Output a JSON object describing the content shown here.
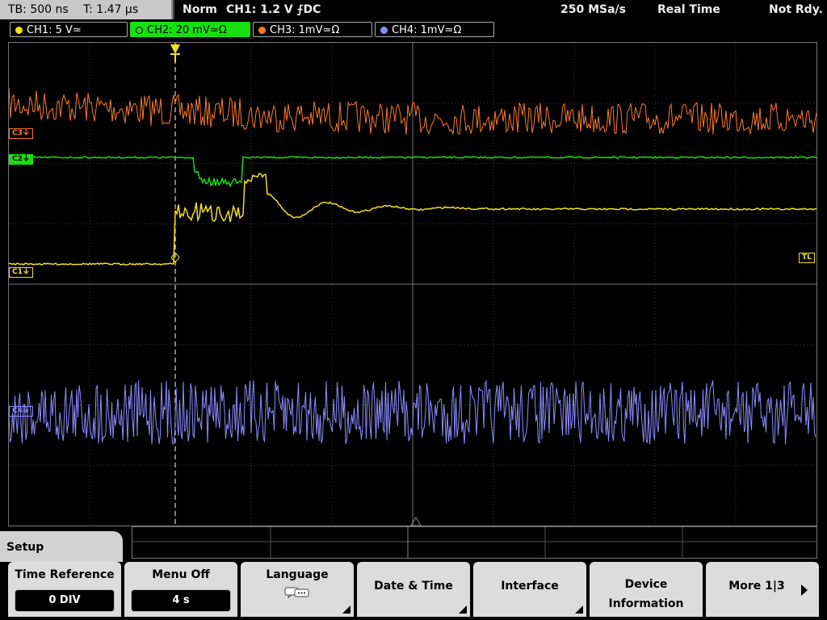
{
  "statusbar": {
    "timebase": "TB: 500 ns",
    "trigger_time": "T: 1.47 µs",
    "mode": "Norm",
    "trigger": "CH1: 1.2 V ⨍DC",
    "sample_rate": "250 MSa/s",
    "acq_mode": "Real Time",
    "state": "Not Rdy."
  },
  "channels": [
    {
      "label": "CH1: 5 V≃",
      "color": "#f0e020"
    },
    {
      "label": "CH2: 20 mV≃Ω",
      "color": "#16e00e"
    },
    {
      "label": "CH3: 1mV≃Ω",
      "color": "#ff7a28"
    },
    {
      "label": "CH4: 1mV≃Ω",
      "color": "#8c8cff"
    }
  ],
  "markers": {
    "c3": "C3⏚",
    "c2": "C2⏚",
    "c1": "C1⏚",
    "c4": "C4⏚",
    "tl": "TL"
  },
  "menu": {
    "title": "Setup"
  },
  "softkeys": {
    "time_reference": {
      "label": "Time Reference",
      "value": "0 DIV"
    },
    "menu_off": {
      "label": "Menu Off",
      "value": "4 s"
    },
    "language": {
      "label": "Language",
      "icon": "speech-bubbles-icon"
    },
    "date_time": {
      "label": "Date & Time"
    },
    "interface": {
      "label": "Interface"
    },
    "device_info": {
      "label1": "Device",
      "label2": "Information"
    },
    "more": {
      "label": "More 1|3"
    }
  },
  "colors": {
    "ch1": "#f0e020",
    "ch2": "#16e00e",
    "ch3": "#ff7a28",
    "ch4": "#8c8cff",
    "softkey_bg": "#dcdcdc"
  }
}
